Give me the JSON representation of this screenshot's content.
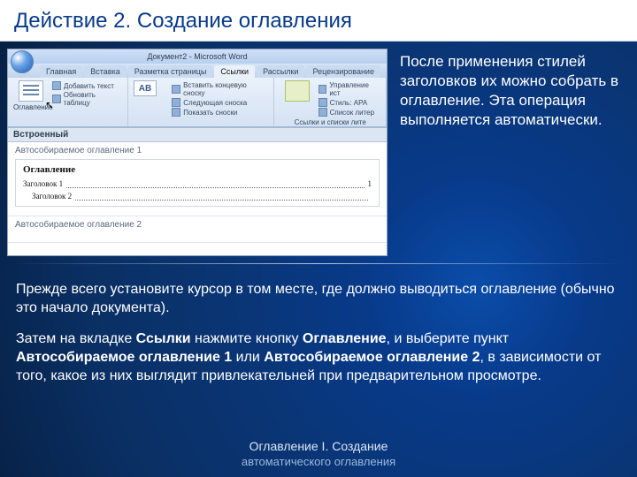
{
  "title": "Действие 2. Создание оглавления",
  "word": {
    "windowTitle": "Документ2 - Microsoft Word",
    "tabs": [
      "Главная",
      "Вставка",
      "Разметка страницы",
      "Ссылки",
      "Рассылки",
      "Рецензирование"
    ],
    "activeTab": "Ссылки",
    "btn_toc": "Оглавление",
    "btn_addText": "Добавить текст",
    "btn_update": "Обновить таблицу",
    "btn_ab": "AB",
    "btn_insertFoot": "Вставить концевую сноску",
    "btn_nextFoot": "Следующая сноска",
    "btn_showFoot": "Показать сноски",
    "btn_manage": "Управление ист",
    "btn_style": "Стиль: APA",
    "btn_biblio": "Список литер",
    "btn_links": "Ссылки и списки лите",
    "gallery_header": "Встроенный",
    "item1_title": "Автособираемое оглавление 1",
    "item2_title": "Автособираемое оглавление 2",
    "preview_head": "Оглавление",
    "preview_l1": "Заголовок 1",
    "preview_l2": "Заголовок 2",
    "page1": "1"
  },
  "side": "После применения стилей заголовков их можно собрать в оглавление. Эта операция выполняется автоматически.",
  "body": {
    "p1": "Прежде всего установите курсор в том месте, где должно выводиться оглавление (обычно это начало документа).",
    "p2a": "Затем на вкладке ",
    "p2b": "Ссылки",
    "p2c": " нажмите кнопку ",
    "p2d": "Оглавление",
    "p2e": ", и выберите пункт ",
    "p2f": "Автособираемое оглавление 1",
    "p2g": " или ",
    "p2h": "Автособираемое оглавление 2",
    "p2i": ", в зависимости от того, какое из них выглядит привлекательней при предварительном просмотре."
  },
  "footer": {
    "l1": "Оглавление I. Создание",
    "l2": "автоматического оглавления"
  }
}
